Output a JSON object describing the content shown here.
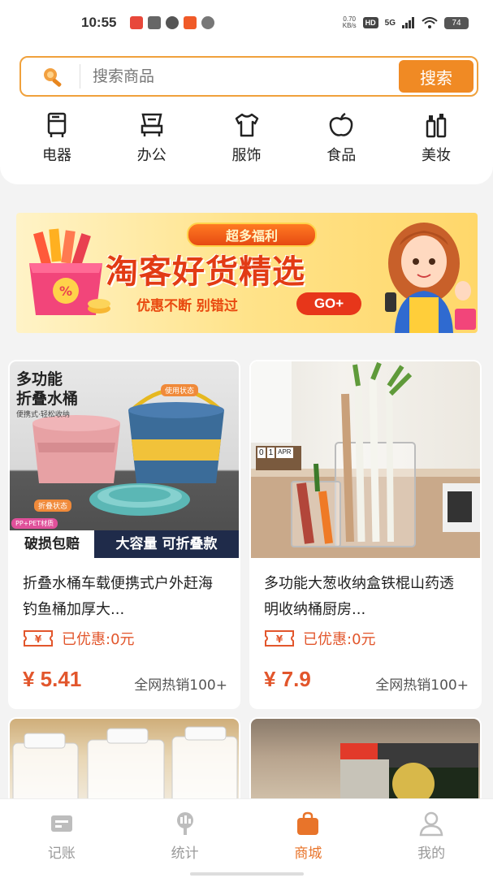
{
  "status_bar": {
    "time": "10:55",
    "net_speed_value": "0.70",
    "net_speed_unit": "KB/s",
    "hd_label": "HD",
    "signal_label": "5G",
    "battery": "74"
  },
  "search": {
    "placeholder": "搜索商品",
    "button_label": "搜索"
  },
  "categories": [
    {
      "label": "电器",
      "icon": "appliance-icon"
    },
    {
      "label": "办公",
      "icon": "office-icon"
    },
    {
      "label": "服饰",
      "icon": "clothing-icon"
    },
    {
      "label": "食品",
      "icon": "food-icon"
    },
    {
      "label": "美妆",
      "icon": "cosmetics-icon"
    }
  ],
  "banner": {
    "tag": "超多福利",
    "title": "淘客好货精选",
    "subtitle": "优惠不断 别错过",
    "cta": "GO+"
  },
  "products": [
    {
      "title": "折叠水桶车载便携式户外赶海钓鱼桶加厚大...",
      "coupon_text": "已优惠:0元",
      "price": "¥ 5.41",
      "sales": "全网热销100+",
      "image_text": {
        "headline_1": "多功能",
        "headline_2": "折叠水桶",
        "tagline": "便携式·轻松收纳",
        "state_used": "使用状态",
        "state_folded": "折叠状态",
        "material": "PP+PET材质",
        "footer_left": "破损包赔",
        "footer_right": "大容量 可折叠款"
      }
    },
    {
      "title": "多功能大葱收纳盒铁棍山药透明收纳桶厨房...",
      "coupon_text": "已优惠:0元",
      "price": "¥ 7.9",
      "sales": "全网热销100+",
      "image_text": {
        "calendar_1": "0",
        "calendar_2": "1",
        "calendar_3": "APR"
      }
    },
    {
      "title": "",
      "image": "storage-containers"
    },
    {
      "title": "",
      "image": "seaweed-package"
    }
  ],
  "bottom_nav": [
    {
      "label": "记账",
      "icon": "ledger-icon",
      "active": false
    },
    {
      "label": "统计",
      "icon": "stats-icon",
      "active": false
    },
    {
      "label": "商城",
      "icon": "shopping-bag-icon",
      "active": true
    },
    {
      "label": "我的",
      "icon": "profile-icon",
      "active": false
    }
  ],
  "colors": {
    "accent": "#f08a24",
    "price": "#e2562c",
    "nav_active": "#e8742a"
  }
}
